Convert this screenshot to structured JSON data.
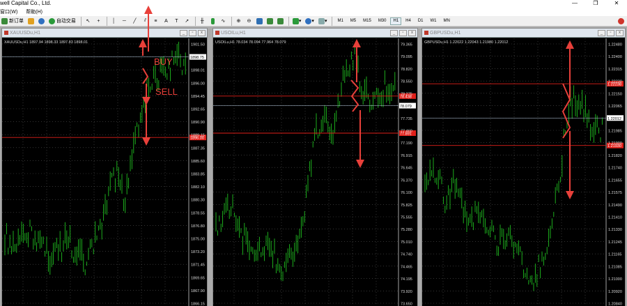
{
  "app": {
    "title": "well Capital Co., Ltd.",
    "window_buttons": [
      "—",
      "❐",
      "✕"
    ]
  },
  "menu": [
    "窗口(W)",
    "帮助(H)"
  ],
  "toolbar": {
    "new_order": "新订单",
    "auto_trade": "自动交易",
    "timeframes": [
      "M1",
      "M5",
      "M15",
      "M30",
      "H1",
      "H4",
      "D1",
      "W1",
      "MN"
    ],
    "active_timeframe": "H1"
  },
  "charts": [
    {
      "title": "XAUUSDu,H1",
      "header": "XAUUSDu,H1  1897.94 1898.33 1897.83 1898.01",
      "price_labels": [
        "1901.50",
        "1898.75",
        "1898.01",
        "1896.00",
        "1894.45",
        "1892.65",
        "1890.90",
        "1889.15",
        "1887.35",
        "1885.60",
        "1883.85",
        "1882.10",
        "1880.30",
        "1878.55",
        "1876.80",
        "1875.00",
        "1873.20",
        "1871.45",
        "1869.65",
        "1867.90",
        "1866.15"
      ],
      "current_price": "1898.01",
      "red_labels": [
        "1896.00"
      ],
      "annotations": {
        "buy": "BUY",
        "sell": "SELL"
      }
    },
    {
      "title": "USOILu,H1",
      "header": "USOILu,H1  78.034 78.094 77.964 78.079",
      "price_labels": [
        "79.365",
        "79.095",
        "78.820",
        "78.550",
        "78.275",
        "78.079",
        "77.735",
        "77.460",
        "77.190",
        "76.915",
        "76.645",
        "76.370",
        "76.100",
        "75.825",
        "75.555",
        "75.280",
        "75.010",
        "74.740",
        "74.465",
        "74.195",
        "73.920",
        "73.650"
      ],
      "current_price": "78.079",
      "red_labels": [
        "78.438",
        "77.891"
      ]
    },
    {
      "title": "GBPUSDu,H1",
      "header": "GBPUSDu,H1  1.22022 1.22043 1.21980 1.22012",
      "price_labels": [
        "1.22480",
        "1.22400",
        "1.22315",
        "1.22230",
        "1.22150",
        "1.22065",
        "1.22012",
        "1.21985",
        "1.21900",
        "1.21820",
        "1.21740",
        "1.21655",
        "1.21575",
        "1.21490",
        "1.21410",
        "1.21330",
        "1.21245",
        "1.21165",
        "1.21085",
        "1.21000",
        "1.20920",
        "1.20840"
      ],
      "current_price": "1.22012",
      "red_labels": [
        "1.22238",
        "1.21930"
      ]
    }
  ]
}
